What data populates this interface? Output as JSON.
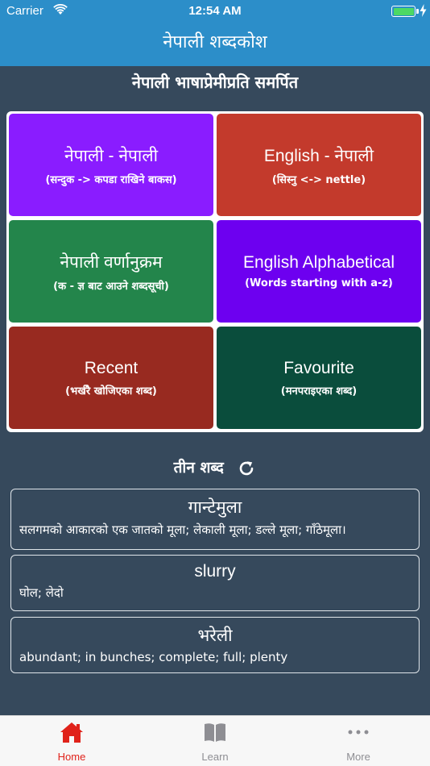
{
  "status_bar": {
    "carrier": "Carrier",
    "time": "12:54 AM"
  },
  "nav": {
    "title": "नेपाली शब्दकोश"
  },
  "subtitle": "नेपाली भाषाप्रेमीप्रति समर्पित",
  "tiles": [
    {
      "title": "नेपाली - नेपाली",
      "sub": "(सन्दुक -> कपडा राखिने बाकस)",
      "color": "#8a1cff"
    },
    {
      "title": "English - नेपाली",
      "sub": "(सिस्नु <-> nettle)",
      "color": "#c33a2c"
    },
    {
      "title": "नेपाली वर्णानुक्रम",
      "sub": "(क - ज्ञ बाट आउने शब्दसूची)",
      "color": "#23854b"
    },
    {
      "title": "English Alphabetical",
      "sub": "(Words starting with a-z)",
      "color": "#6d00f0"
    },
    {
      "title": "Recent",
      "sub": "(भर्खरै खोजिएका शब्द)",
      "color": "#982a20"
    },
    {
      "title": "Favourite",
      "sub": "(मनपराइएका शब्द)",
      "color": "#0a4d3c"
    }
  ],
  "words_section": {
    "title": "तीन शब्द",
    "refresh_icon": "refresh-icon"
  },
  "words": [
    {
      "word": "गान्टेमुला",
      "definition": "सलगमको आकारको एक जातको मूला; लेकाली मूला; डल्ले मूला; गाँठेमूला।"
    },
    {
      "word": "slurry",
      "definition": "घोल; लेदो"
    },
    {
      "word": "भरेली",
      "definition": "abundant; in bunches; complete; full; plenty"
    }
  ],
  "tab_bar": {
    "tabs": [
      {
        "label": "Home",
        "icon": "home-icon",
        "active": true
      },
      {
        "label": "Learn",
        "icon": "book-icon",
        "active": false
      },
      {
        "label": "More",
        "icon": "more-icon",
        "active": false
      }
    ]
  },
  "colors": {
    "nav_bg": "#2c8ec9",
    "page_bg": "#36495c",
    "active_tab": "#e0221a"
  }
}
